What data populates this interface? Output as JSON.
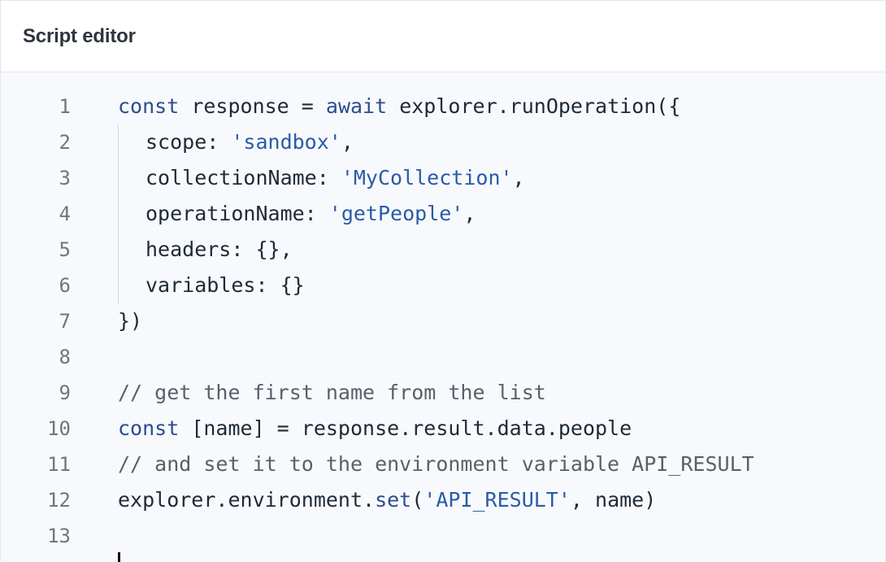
{
  "header": {
    "title": "Script editor"
  },
  "editor": {
    "lines": [
      {
        "n": "1",
        "t": [
          [
            "kw",
            "const"
          ],
          [
            "plain",
            " response = "
          ],
          [
            "kw",
            "await"
          ],
          [
            "plain",
            " explorer.runOperation({"
          ]
        ]
      },
      {
        "n": "2",
        "t": [
          [
            "plain",
            "scope: "
          ],
          [
            "str",
            "'sandbox'"
          ],
          [
            "plain",
            ","
          ]
        ]
      },
      {
        "n": "3",
        "t": [
          [
            "plain",
            "collectionName: "
          ],
          [
            "str",
            "'MyCollection'"
          ],
          [
            "plain",
            ","
          ]
        ]
      },
      {
        "n": "4",
        "t": [
          [
            "plain",
            "operationName: "
          ],
          [
            "str",
            "'getPeople'"
          ],
          [
            "plain",
            ","
          ]
        ]
      },
      {
        "n": "5",
        "t": [
          [
            "plain",
            "headers: {},"
          ]
        ]
      },
      {
        "n": "6",
        "t": [
          [
            "plain",
            "variables: {}"
          ]
        ]
      },
      {
        "n": "7",
        "t": [
          [
            "plain",
            "})"
          ]
        ]
      },
      {
        "n": "8",
        "t": []
      },
      {
        "n": "9",
        "t": [
          [
            "com",
            "// get the first name from the list"
          ]
        ]
      },
      {
        "n": "10",
        "t": [
          [
            "kw",
            "const"
          ],
          [
            "plain",
            " [name] = response.result.data.people"
          ]
        ]
      },
      {
        "n": "11",
        "t": [
          [
            "com",
            "// and set it to the environment variable API_RESULT"
          ]
        ]
      },
      {
        "n": "12",
        "t": [
          [
            "plain",
            "explorer.environment."
          ],
          [
            "kw",
            "set"
          ],
          [
            "plain",
            "("
          ],
          [
            "str",
            "'API_RESULT'"
          ],
          [
            "plain",
            ", name)"
          ]
        ]
      },
      {
        "n": "13",
        "t": []
      }
    ],
    "colors": {
      "keyword": "#2c4d8f",
      "string": "#2a5aa8",
      "comment": "#5a6069",
      "text": "#1f2a37",
      "line_number": "#70757e",
      "background": "#f7f9fc"
    }
  }
}
